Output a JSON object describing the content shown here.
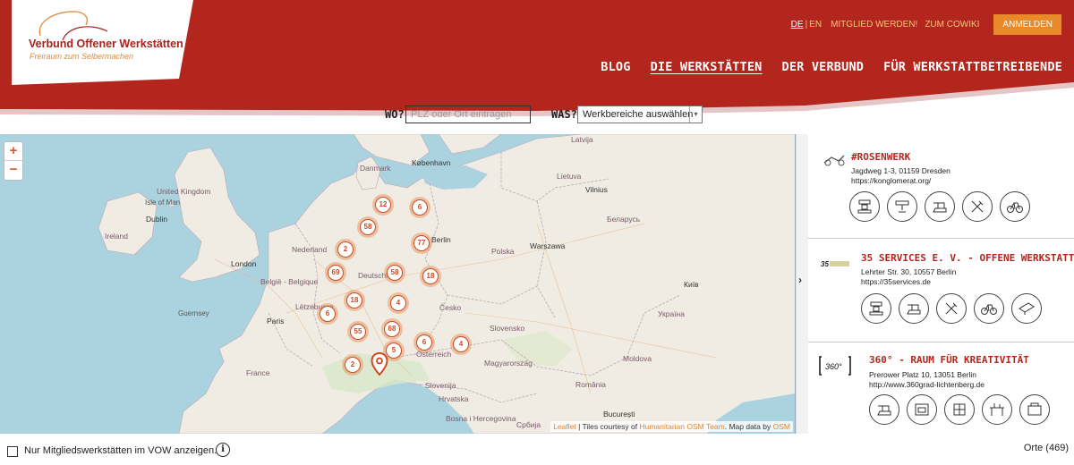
{
  "header": {
    "logo_title": "Verbund Offener Werkstätten",
    "logo_subtitle": "Freiraum zum Selbermachen",
    "lang_de": "DE",
    "lang_en": "EN",
    "links": [
      "MITGLIED WERDEN!",
      "ZUM COWIKI"
    ],
    "login": "ANMELDEN",
    "nav": [
      "BLOG",
      "DIE WERKSTÄTTEN",
      "DER VERBUND",
      "FÜR WERKSTATTBETREIBENDE"
    ],
    "active_nav": "DIE WERKSTÄTTEN",
    "brand_color": "#b3261e",
    "accent_color": "#e8892a"
  },
  "search": {
    "wo_label": "WO?",
    "wo_placeholder": "PLZ oder Ort eintragen",
    "was_label": "WAS?",
    "was_value": "Werkbereiche auswählen"
  },
  "map": {
    "zoom_in": "+",
    "zoom_out": "−",
    "labels": {
      "latvija": "Latvija",
      "kobenhavn": "København",
      "danmark": "Danmark",
      "lietuva": "Lietuva",
      "vilnius": "Vilnius",
      "uk": "United Kingdom",
      "isle_of_man": "Isle of Man",
      "dublin": "Dublin",
      "ireland": "Ireland",
      "belarus": "Беларусь",
      "nederland": "Nederland",
      "london": "London",
      "polska": "Polska",
      "warszawa": "Warszawa",
      "deutschland": "Deutschland",
      "berlin": "Berlin",
      "belgie": "België - Belgique",
      "guernsey": "Guernsey",
      "paris": "Paris",
      "letzebuerg": "Lëtzebuerg",
      "cesko": "Česko",
      "ukraina": "Україна",
      "kyiv": "Київ",
      "slovensko": "Slovensko",
      "osterreich": "Österreich",
      "magyarorszag": "Magyarország",
      "moldova": "Moldova",
      "france": "France",
      "slovenija": "Slovenija",
      "hrvatska": "Hrvatska",
      "romania": "România",
      "bucuresti": "București",
      "bosna": "Bosna i Hercegovina",
      "srbija": "Србија"
    },
    "clusters": [
      "12",
      "6",
      "58",
      "77",
      "2",
      "69",
      "58",
      "18",
      "18",
      "4",
      "6",
      "68",
      "55",
      "5",
      "6",
      "4",
      "2"
    ],
    "attribution_leaflet": "Leaflet",
    "attribution_tiles": "| Tiles courtesy of",
    "attribution_hot": "Humanitarian OSM Team",
    "attribution_data": ". Map data by",
    "attribution_osm": "OSM"
  },
  "list": {
    "entries": [
      {
        "name": "#ROSENWERK",
        "address": "Jagdweg 1-3, 01159 Dresden",
        "url": "https://konglomerat.org/"
      },
      {
        "name": "35 SERVICES E. V. - OFFENE WERKSTATT",
        "address": "Lehrter Str. 30, 10557 Berlin",
        "url": "https://35services.de"
      },
      {
        "name": "360° - RAUM FÜR KREATIVITÄT",
        "address": "Prerower Platz 10, 13051 Berlin",
        "url": "http://www.360grad-lichtenberg.de",
        "thumb_text": "360°"
      }
    ]
  },
  "footer": {
    "member_label": "Nur Mitgliedswerkstätten im VOW anzeigen.",
    "info_icon": "i",
    "count": "Orte (469)"
  },
  "toggle_icon": "chevron-right-icon"
}
